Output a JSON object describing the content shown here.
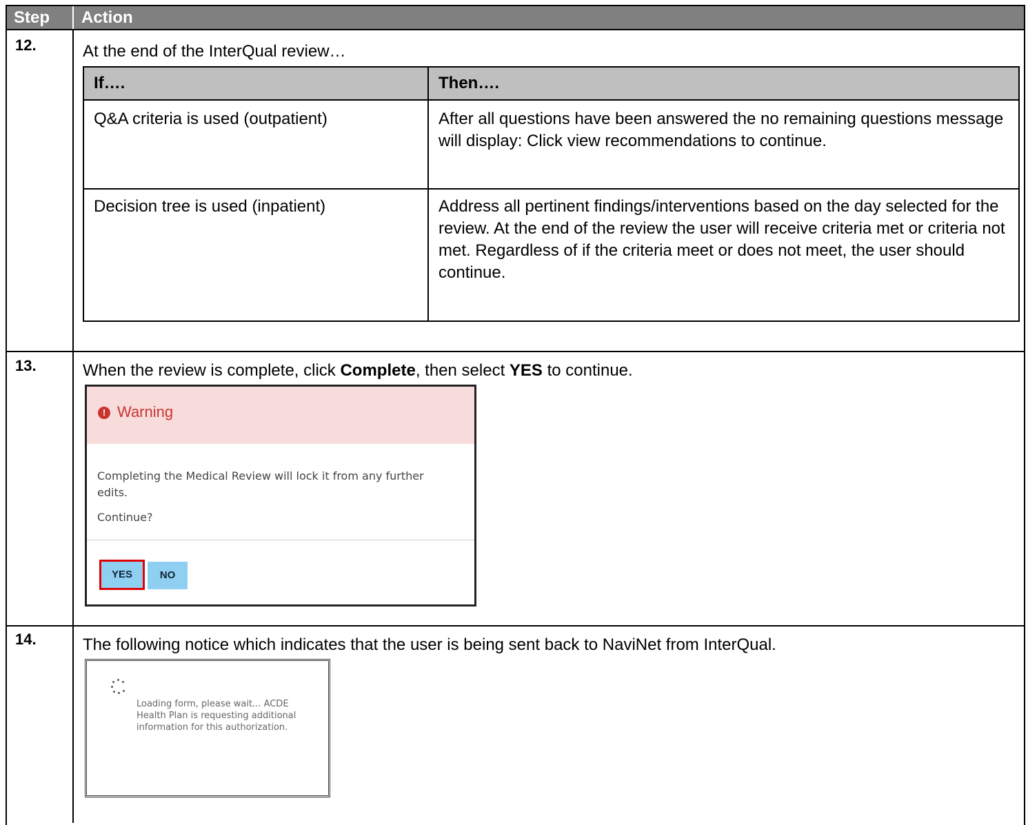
{
  "header": {
    "step": "Step",
    "action": "Action"
  },
  "steps": [
    {
      "number": "12.",
      "text": "At the end of the InterQual review…"
    },
    {
      "number": "13.",
      "text_before": "When the review is complete, click ",
      "bold1": "Complete",
      "text_mid": ", then select ",
      "bold2": "YES",
      "text_after": " to continue."
    },
    {
      "number": "14.",
      "text": "The following notice which indicates that the user is being sent back to NaviNet from InterQual."
    }
  ],
  "if_then": {
    "header_if": "If….",
    "header_then": "Then….",
    "rows": [
      {
        "if": "Q&A criteria is used (outpatient)",
        "then": "After all questions have been answered the no remaining questions message will display: Click view recommendations to continue."
      },
      {
        "if": "Decision tree is used (inpatient)",
        "then": "Address all pertinent findings/interventions based on the day selected for the review. At the end of the review the user will receive criteria met or criteria not met. Regardless of if the criteria meet or does not meet, the user should continue."
      }
    ]
  },
  "warning_dialog": {
    "icon": "exclamation-circle-icon",
    "title": "Warning",
    "message": "Completing the Medical Review will lock it from any further edits.",
    "prompt": "Continue?",
    "yes_label": "YES",
    "no_label": "NO",
    "highlight_color": "#e00000"
  },
  "loading_notice": {
    "icon": "spinner-icon",
    "message": "Loading form, please wait... ACDE Health Plan is requesting additional information for this authorization."
  }
}
